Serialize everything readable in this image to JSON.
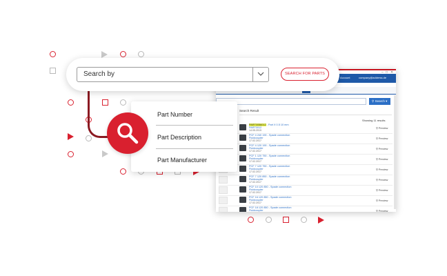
{
  "search_bar": {
    "select_label": "Search by",
    "button_label": "SEARCH FOR PARTS"
  },
  "dropdown": {
    "items": [
      "Part Number",
      "Part Description",
      "Part Manufacturer"
    ]
  },
  "screenshot": {
    "topbar_left": "Account",
    "topbar_right": "company@address.de",
    "search_button": "Search",
    "results_header": "Search Result",
    "showing": "Showing 11 results",
    "preview_label": "Preview",
    "rows": [
      {
        "line1": "PART0056012",
        "line1_suffix": " - Part X 0.5 10 mm",
        "line2": "PART0012",
        "line3": "14.05.2019",
        "highlight": true
      },
      {
        "line1": "PCF 4 240 190 - Spade connection",
        "line2": "Fluidcoupler",
        "line3": "17.02.2017"
      },
      {
        "line1": "PCF 4 120 190 - Spade connection",
        "line2": "Fluidcoupler",
        "line3": "17.02.2017"
      },
      {
        "line1": "PCF 1 120 750 - Spade connection",
        "line2": "Fluidcoupler",
        "line3": "17.02.2017"
      },
      {
        "line1": "PCF 7 120 750 - Spade connection",
        "line2": "Fluidcoupler",
        "line3": "17.02.2017"
      },
      {
        "line1": "PCF 7 120 850 - Spade connection",
        "line2": "Fluidcoupler",
        "line3": "17.02.2017"
      },
      {
        "line1": "PCF 10 120 850 - Spade connection",
        "line2": "Fluidcoupler",
        "line3": "17.02.2017"
      },
      {
        "line1": "PCF 16 120 850 - Spade connection",
        "line2": "Fluidcoupler",
        "line3": "17.02.2017"
      },
      {
        "line1": "PCF 18 120 850 - Spade connection",
        "line2": "Fluidcoupler",
        "line3": "17.02.2017"
      }
    ]
  },
  "icons": {
    "search": "search-icon",
    "chevron": "chevron-down-icon",
    "preview": "magnifier-icon"
  },
  "colors": {
    "accent": "#d9202f",
    "accent_dark": "#8b1a22",
    "link": "#2b6fc6",
    "topbar": "#1e59a8"
  }
}
